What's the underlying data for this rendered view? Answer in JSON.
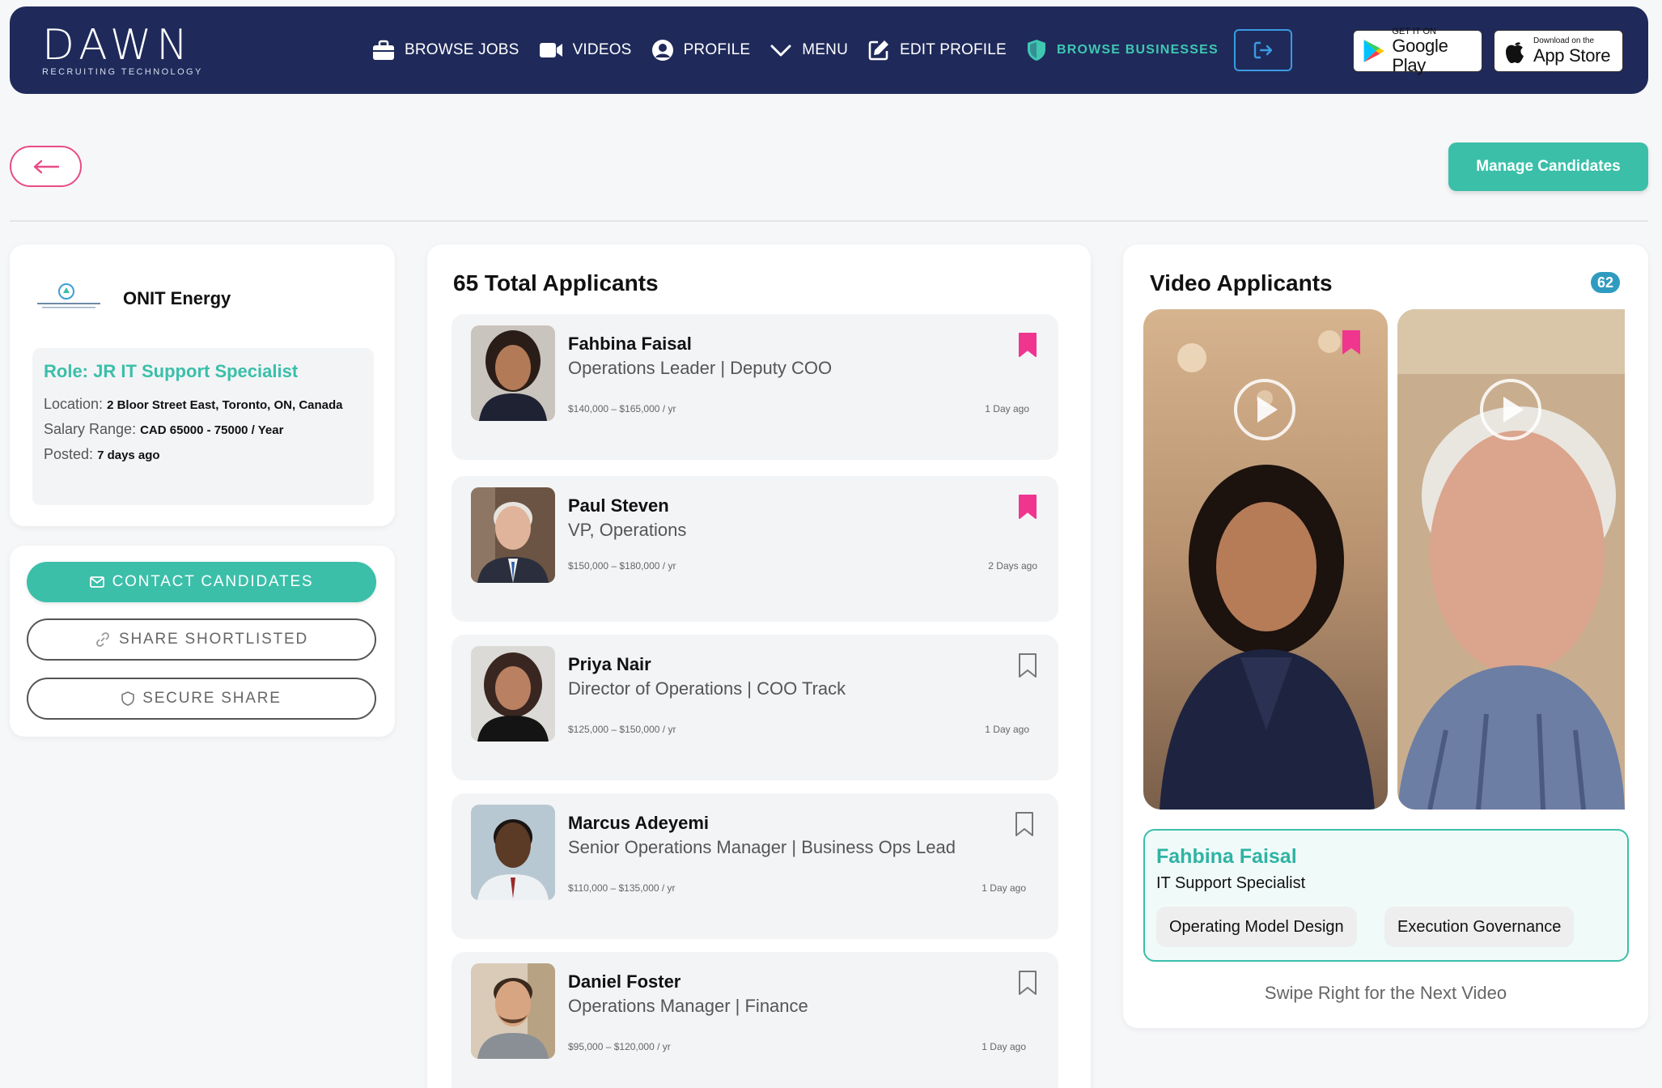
{
  "brand": {
    "name": "DAWN",
    "tagline": "RECRUITING TECHNOLOGY"
  },
  "nav": [
    {
      "label": "BROWSE JOBS",
      "icon": "briefcase-icon"
    },
    {
      "label": "VIDEOS",
      "icon": "video-camera-icon"
    },
    {
      "label": "PROFILE",
      "icon": "user-circle-icon"
    },
    {
      "label": "MENU",
      "icon": "chevron-down-icon"
    },
    {
      "label": "EDIT PROFILE",
      "icon": "edit-icon"
    },
    {
      "label": "BROWSE BUSINESSES",
      "icon": "shield-icon",
      "active": true
    }
  ],
  "stores": {
    "google_small": "GET IT ON",
    "google_big": "Google Play",
    "apple_small": "Download on the",
    "apple_big": "App Store"
  },
  "toolbar": {
    "manage_label": "Manage Candidates"
  },
  "company": {
    "name": "ONIT Energy",
    "role": "Role: JR IT Support Specialist",
    "location_label": "Location:",
    "location_value": "2 Bloor Street East, Toronto, ON, Canada",
    "salary_label": "Salary Range:",
    "salary_value": "CAD 65000 - 75000 / Year",
    "posted_label": "Posted:",
    "posted_value": "7 days ago"
  },
  "actions": {
    "contact": "CONTACT CANDIDATES",
    "share": "SHARE SHORTLISTED",
    "secure": "SECURE SHARE"
  },
  "applicants": {
    "title": "65 Total Applicants",
    "items": [
      {
        "name": "Fahbina Faisal",
        "title": "Operations Leader | Deputy COO",
        "salary": "$140,000 – $165,000 / yr",
        "time": "1 Day ago",
        "bookmarked": true
      },
      {
        "name": "Paul Steven",
        "title": "VP, Operations",
        "salary": "$150,000 – $180,000 / yr",
        "time": "2 Days ago",
        "bookmarked": true
      },
      {
        "name": "Priya Nair",
        "title": "Director of Operations | COO Track",
        "salary": "$125,000 – $150,000 / yr",
        "time": "1 Day ago",
        "bookmarked": false
      },
      {
        "name": "Marcus Adeyemi",
        "title": "Senior Operations Manager | Business Ops Lead",
        "salary": "$110,000 – $135,000 / yr",
        "time": "1 Day ago",
        "bookmarked": false
      },
      {
        "name": "Daniel Foster",
        "title": "Operations Manager | Finance",
        "salary": "$95,000 – $120,000 / yr",
        "time": "1 Day ago",
        "bookmarked": false
      }
    ]
  },
  "video": {
    "title": "Video Applicants",
    "count": "62",
    "current_name": "Fahbina Faisal",
    "current_role": "IT Support Specialist",
    "skills": [
      "Operating Model Design",
      "Execution Governance"
    ],
    "hint": "Swipe Right for the Next Video"
  },
  "colors": {
    "navy": "#1f2a5a",
    "teal": "#3bbfa9",
    "pink": "#f0358f"
  }
}
